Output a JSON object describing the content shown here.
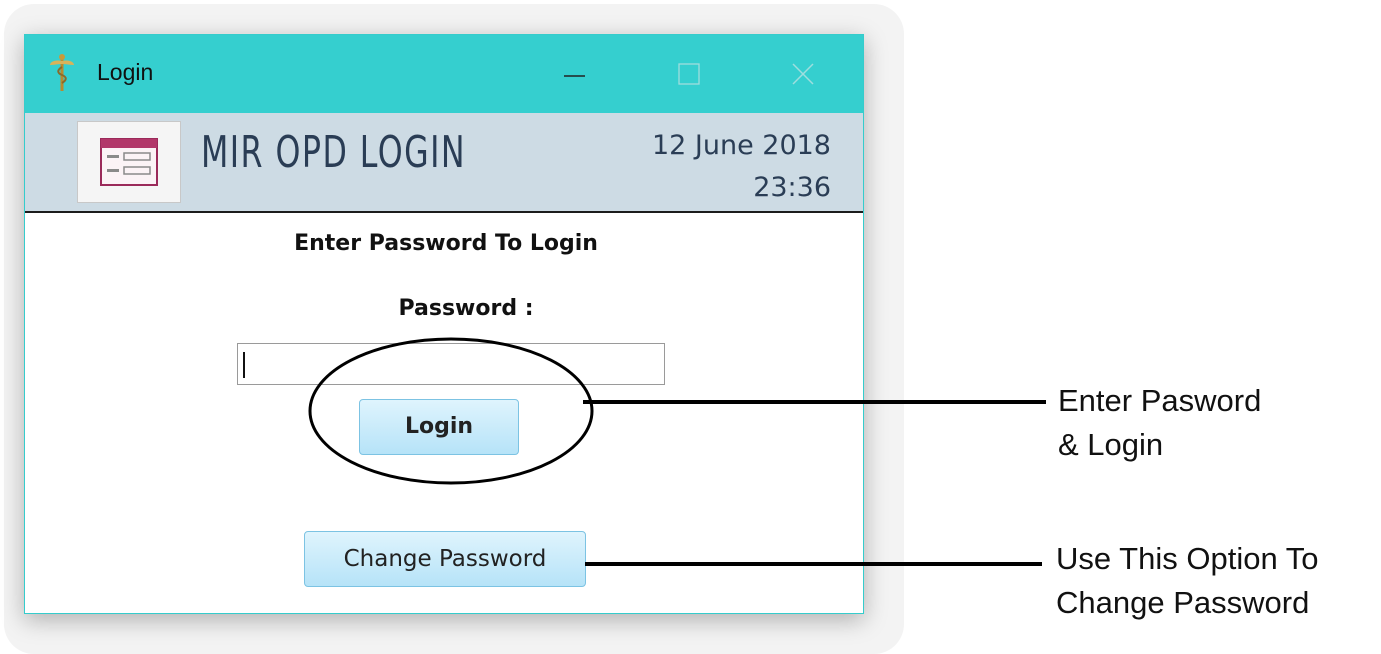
{
  "window": {
    "title": "Login",
    "app_icon": "caduceus-icon",
    "controls": [
      "minimize-icon",
      "maximize-icon",
      "close-icon"
    ]
  },
  "header": {
    "icon": "form-window-icon",
    "title": "MIR OPD LOGIN",
    "date": "12 June 2018",
    "time": "23:36"
  },
  "form": {
    "prompt": "Enter Password To Login",
    "password_label": "Password :",
    "password_value": "",
    "login_label": "Login",
    "change_password_label": "Change Password"
  },
  "annotations": {
    "login_note_line1": "Enter Pasword",
    "login_note_line2": "& Login",
    "change_note_line1": "Use This Option To",
    "change_note_line2": "Change Password"
  },
  "colors": {
    "titlebar": "#35cfcf",
    "header_band": "#cddbe4",
    "button_fill": "#b6e3f8",
    "button_border": "#7cc3e3"
  }
}
